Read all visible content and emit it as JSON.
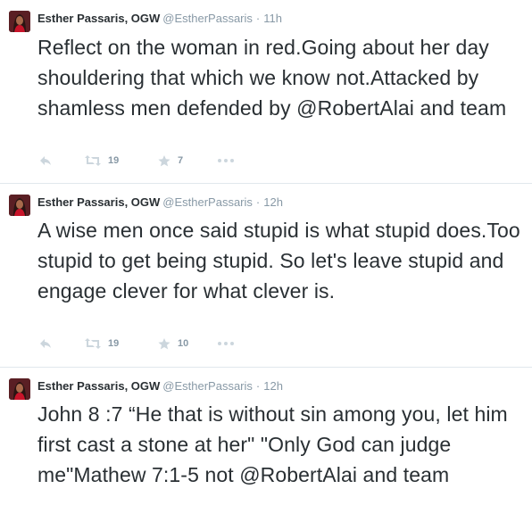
{
  "tweets": [
    {
      "author": {
        "name": "Esther Passaris, OGW",
        "handle": "@EstherPassaris"
      },
      "time": "11h",
      "text_before": "Reflect on the woman in red.Going about her day shouldering that which we know not.Attacked by shamless men defended by ",
      "mention": "@RobertAlai",
      "text_after": " and team",
      "retweets": "19",
      "favorites": "7"
    },
    {
      "author": {
        "name": "Esther Passaris, OGW",
        "handle": "@EstherPassaris"
      },
      "time": "12h",
      "text": "A wise men once said stupid is what stupid does.Too stupid to get being stupid. So let's leave stupid and engage clever for what clever is.",
      "retweets": "19",
      "favorites": "10"
    },
    {
      "author": {
        "name": "Esther Passaris, OGW",
        "handle": "@EstherPassaris"
      },
      "time": "12h",
      "text_before": "John 8 :7 “He that is without sin among you, let him first cast a stone at her\" \"Only God can judge me\"Mathew 7:1-5 not ",
      "mention": "@RobertAlai",
      "text_after": " and team"
    }
  ],
  "dot_separator": "·",
  "icons": {
    "reply": "reply-arrow-icon",
    "retweet": "retweet-icon",
    "favorite": "star-icon",
    "more": "more-dots-icon"
  },
  "colors": {
    "text": "#292f33",
    "secondary": "#8899a6",
    "divider": "#e1e8ed"
  }
}
